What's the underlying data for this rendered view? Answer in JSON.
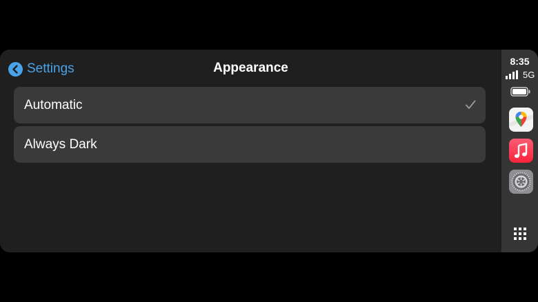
{
  "navbar": {
    "back_label": "Settings",
    "title": "Appearance"
  },
  "options": [
    {
      "label": "Automatic",
      "selected": true
    },
    {
      "label": "Always Dark",
      "selected": false
    }
  ],
  "status": {
    "time": "8:35",
    "network": "5G"
  },
  "dock": {
    "apps": [
      "maps-icon",
      "music-icon",
      "settings-icon"
    ],
    "launcher": "app-grid-icon"
  },
  "colors": {
    "accent": "#4aa3e8",
    "background": "#1f1f1f",
    "row": "#3a3a3a",
    "sidebar": "#353535"
  }
}
